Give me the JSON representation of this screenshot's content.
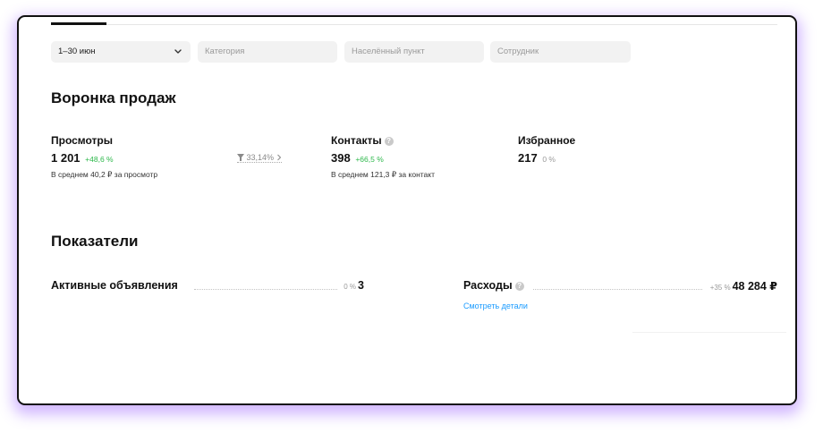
{
  "filters": {
    "date": "1–30 июн",
    "category_placeholder": "Категория",
    "location_placeholder": "Населённый пункт",
    "employee_placeholder": "Сотрудник"
  },
  "funnel": {
    "title": "Воронка продаж",
    "views": {
      "label": "Просмотры",
      "value": "1 201",
      "delta": "+48,6 %",
      "sub": "В среднем 40,2 ₽ за просмотр"
    },
    "conversion": "33,14%",
    "contacts": {
      "label": "Контакты",
      "value": "398",
      "delta": "+66,5 %",
      "sub": "В среднем 121,3 ₽ за контакт"
    },
    "favorites": {
      "label": "Избранное",
      "value": "217",
      "delta": "0 %"
    }
  },
  "indicators": {
    "title": "Показатели",
    "active_ads": {
      "label": "Активные объявления",
      "pct": "0 %",
      "value": "3"
    },
    "expenses": {
      "label": "Расходы",
      "pct": "+35 %",
      "value": "48 284 ₽",
      "link": "Смотреть детали"
    }
  },
  "colors": {
    "positive": "#2db84b",
    "link": "#1a9bff",
    "frame_glow": "#965aff"
  },
  "icons": [
    "chevron-down-icon",
    "help-icon",
    "funnel-icon",
    "chevron-right-icon"
  ]
}
